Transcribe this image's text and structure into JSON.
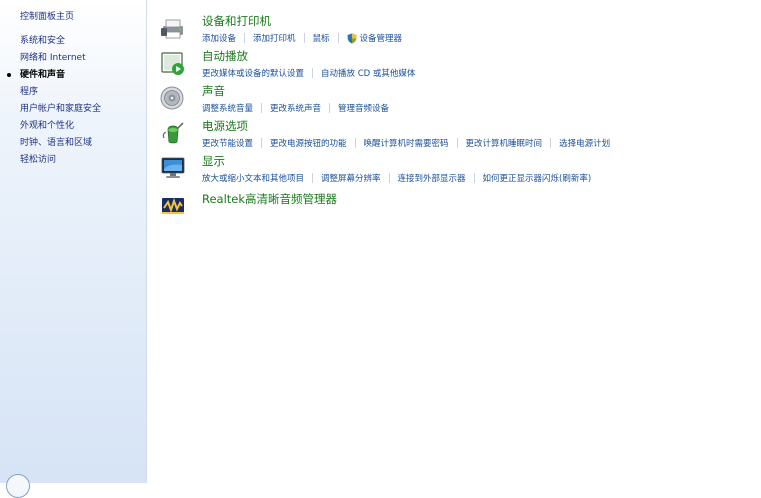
{
  "sidebar": {
    "home": "控制面板主页",
    "items": [
      {
        "label": "系统和安全",
        "current": false
      },
      {
        "label": "网络和 Internet",
        "current": false
      },
      {
        "label": "硬件和声音",
        "current": true
      },
      {
        "label": "程序",
        "current": false
      },
      {
        "label": "用户帐户和家庭安全",
        "current": false
      },
      {
        "label": "外观和个性化",
        "current": false
      },
      {
        "label": "时钟、语言和区域",
        "current": false
      },
      {
        "label": "轻松访问",
        "current": false
      }
    ]
  },
  "categories": {
    "devices": {
      "title": "设备和打印机",
      "icon": "printer-icon",
      "links": [
        "添加设备",
        "添加打印机",
        "鼠标",
        "设备管理器"
      ]
    },
    "autoplay": {
      "title": "自动播放",
      "icon": "autoplay-icon",
      "links": [
        "更改媒体或设备的默认设置",
        "自动播放 CD 或其他媒体"
      ]
    },
    "sound": {
      "title": "声音",
      "icon": "speaker-icon",
      "links": [
        "调整系统音量",
        "更改系统声音",
        "管理音频设备"
      ]
    },
    "power": {
      "title": "电源选项",
      "icon": "power-icon",
      "links": [
        "更改节能设置",
        "更改电源按钮的功能",
        "唤醒计算机时需要密码",
        "更改计算机睡眠时间",
        "选择电源计划"
      ]
    },
    "display": {
      "title": "显示",
      "icon": "monitor-icon",
      "links": [
        "放大或缩小文本和其他项目",
        "调整屏幕分辨率",
        "连接到外部显示器",
        "如何更正显示器闪烁(刷新率)"
      ]
    },
    "realtek": {
      "title": "Realtek高清晰音频管理器",
      "icon": "realtek-icon"
    }
  },
  "colors": {
    "title_green": "#1a7a1a",
    "link_blue": "#1a4f9c",
    "sidebar_text": "#1e3287"
  }
}
